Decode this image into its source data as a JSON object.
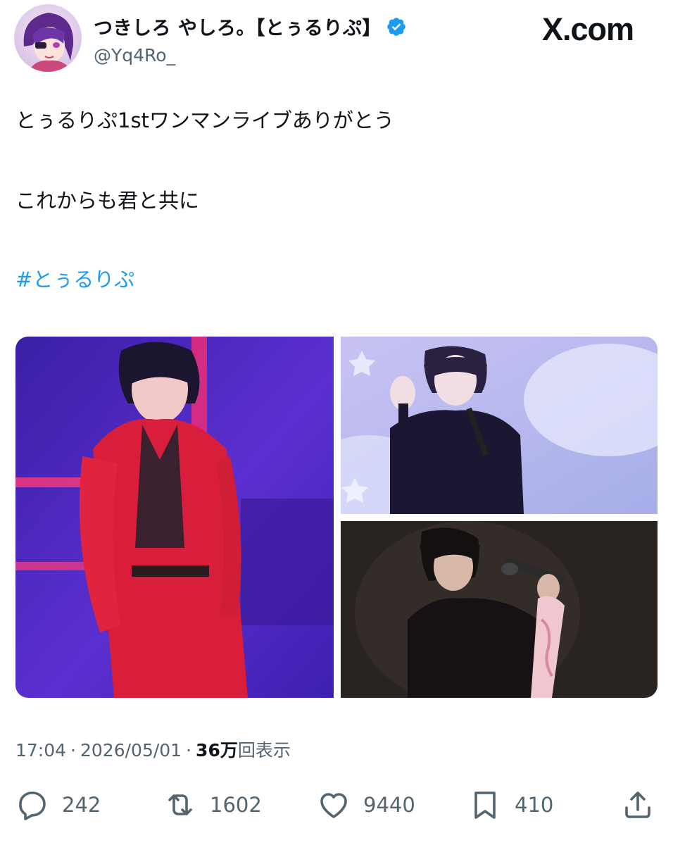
{
  "author": {
    "display_name": "つきしろ やしろ。【とぅるりぷ】",
    "handle": "@Yq4Ro_",
    "verified_icon": "verified-badge-icon"
  },
  "brand": {
    "logo_text": "X.com"
  },
  "tweet": {
    "line1": "とぅるりぷ1stワンマンライブありがとう",
    "line2": "これからも君と共に",
    "hashtag": "#とぅるりぷ"
  },
  "media": {
    "count": 3
  },
  "meta": {
    "time": "17:04",
    "separator": "·",
    "date": "2026/05/01",
    "views_value": "36万",
    "views_label": "回表示"
  },
  "actions": {
    "reply_count": "242",
    "retweet_count": "1602",
    "like_count": "9440",
    "bookmark_count": "410"
  },
  "colors": {
    "link": "#1d9bf0",
    "secondary_text": "#536471",
    "primary_text": "#0f1419"
  }
}
